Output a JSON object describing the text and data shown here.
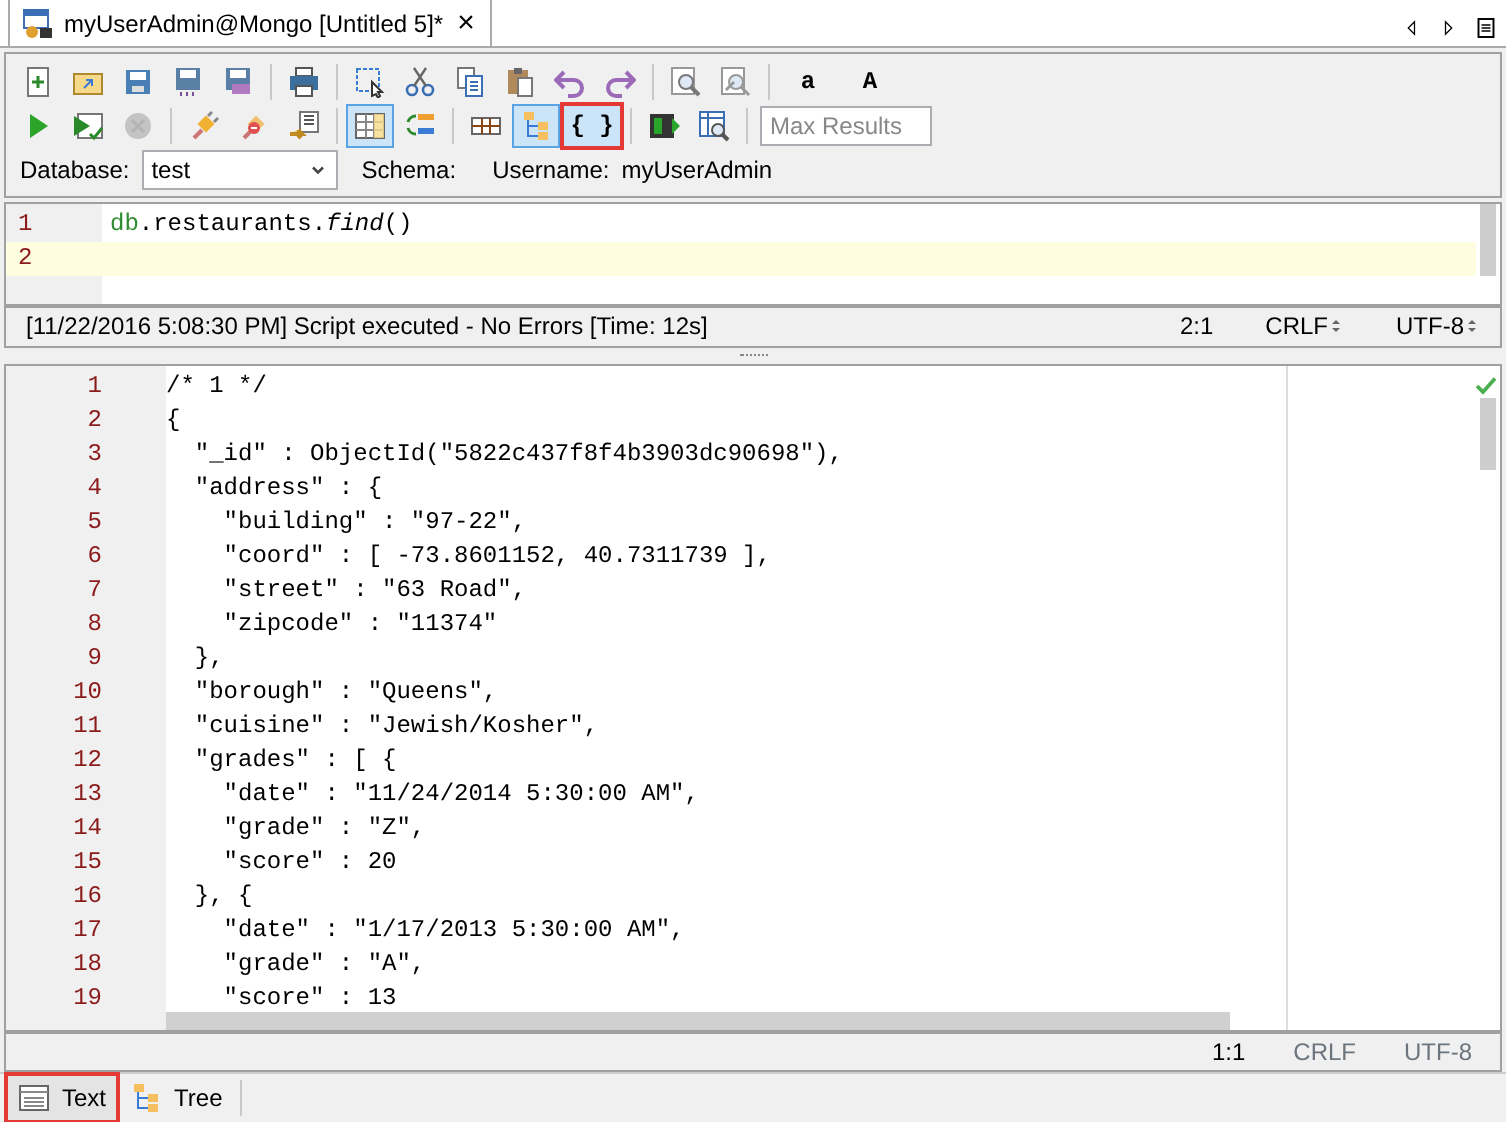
{
  "tabs": [
    {
      "title": "myUserAdmin@Mongo [Untitled 5]*",
      "close": "×",
      "selected": true
    }
  ],
  "toolbar": {
    "rows": [
      [
        {
          "kind": "new"
        },
        {
          "kind": "open"
        },
        {
          "kind": "save"
        },
        {
          "kind": "saveas"
        },
        {
          "kind": "saveall"
        },
        {
          "kind": "sep"
        },
        {
          "kind": "print"
        },
        {
          "kind": "sep"
        },
        {
          "kind": "select"
        },
        {
          "kind": "cut"
        },
        {
          "kind": "copy"
        },
        {
          "kind": "paste"
        },
        {
          "kind": "undo"
        },
        {
          "kind": "redo"
        },
        {
          "kind": "sep"
        },
        {
          "kind": "find"
        },
        {
          "kind": "replace"
        },
        {
          "kind": "sep"
        },
        {
          "kind": "text",
          "label": "a"
        },
        {
          "kind": "text",
          "label": "A"
        }
      ],
      [
        {
          "kind": "run"
        },
        {
          "kind": "runline"
        },
        {
          "kind": "stop",
          "disabled": true
        },
        {
          "kind": "sep"
        },
        {
          "kind": "connect"
        },
        {
          "kind": "disconnect"
        },
        {
          "kind": "import"
        },
        {
          "kind": "sep"
        },
        {
          "kind": "grid",
          "selected": true
        },
        {
          "kind": "refresh"
        },
        {
          "kind": "sep"
        },
        {
          "kind": "table"
        },
        {
          "kind": "tree",
          "selected": true
        },
        {
          "kind": "text",
          "label": "{ }",
          "selected": true,
          "highlighted": true
        },
        {
          "kind": "sep"
        },
        {
          "kind": "terminal"
        },
        {
          "kind": "inspect"
        },
        {
          "kind": "sep"
        },
        {
          "kind": "field",
          "placeholder": "Max Results"
        }
      ]
    ],
    "database_label": "Database:",
    "database": "test",
    "schema_label": "Schema:",
    "username_label": "Username:",
    "username": "myUserAdmin"
  },
  "query_editor": {
    "lines": [
      {
        "number": "1",
        "code": "db.restaurants.*find*()",
        "current": false
      },
      {
        "number": "2",
        "current": true
      }
    ]
  },
  "query_status": {
    "message": "[11/22/2016 5:08:30 PM] Script executed - No Errors [Time: 12s]",
    "position": "2:1",
    "line_ending": "CRLF",
    "encoding": "UTF-8"
  },
  "result_editor": {
    "lines": [
      {
        "number": "1",
        "code": "/* 1 */"
      },
      {
        "number": "2",
        "code": "{"
      },
      {
        "number": "3",
        "code": "  \"_id\" : ObjectId(\"5822c437f8f4b3903dc90698\"),"
      },
      {
        "number": "4",
        "code": "  \"address\" : {"
      },
      {
        "number": "5",
        "code": "    \"building\" : \"97-22\","
      },
      {
        "number": "6",
        "code": "    \"coord\" : [ -73.8601152, 40.7311739 ],"
      },
      {
        "number": "7",
        "code": "    \"street\" : \"63 Road\","
      },
      {
        "number": "8",
        "code": "    \"zipcode\" : \"11374\""
      },
      {
        "number": "9",
        "code": "  },"
      },
      {
        "number": "10",
        "code": "  \"borough\" : \"Queens\","
      },
      {
        "number": "11",
        "code": "  \"cuisine\" : \"Jewish/Kosher\","
      },
      {
        "number": "12",
        "code": "  \"grades\" : [ {"
      },
      {
        "number": "13",
        "code": "    \"date\" : \"11/24/2014 5:30:00 AM\","
      },
      {
        "number": "14",
        "code": "    \"grade\" : \"Z\","
      },
      {
        "number": "15",
        "code": "    \"score\" : 20"
      },
      {
        "number": "16",
        "code": "  }, {"
      },
      {
        "number": "17",
        "code": "    \"date\" : \"1/17/2013 5:30:00 AM\","
      },
      {
        "number": "18",
        "code": "    \"grade\" : \"A\","
      },
      {
        "number": "19",
        "code": "    \"score\" : 13"
      }
    ]
  },
  "result_status": {
    "position": "1:1",
    "line_ending": "CRLF",
    "encoding": "UTF-8"
  },
  "view_tabs": [
    {
      "label": "Text",
      "kind": "text",
      "selected": true,
      "highlighted": true
    },
    {
      "label": "Tree",
      "kind": "tree",
      "selected": false,
      "highlighted": false
    }
  ]
}
